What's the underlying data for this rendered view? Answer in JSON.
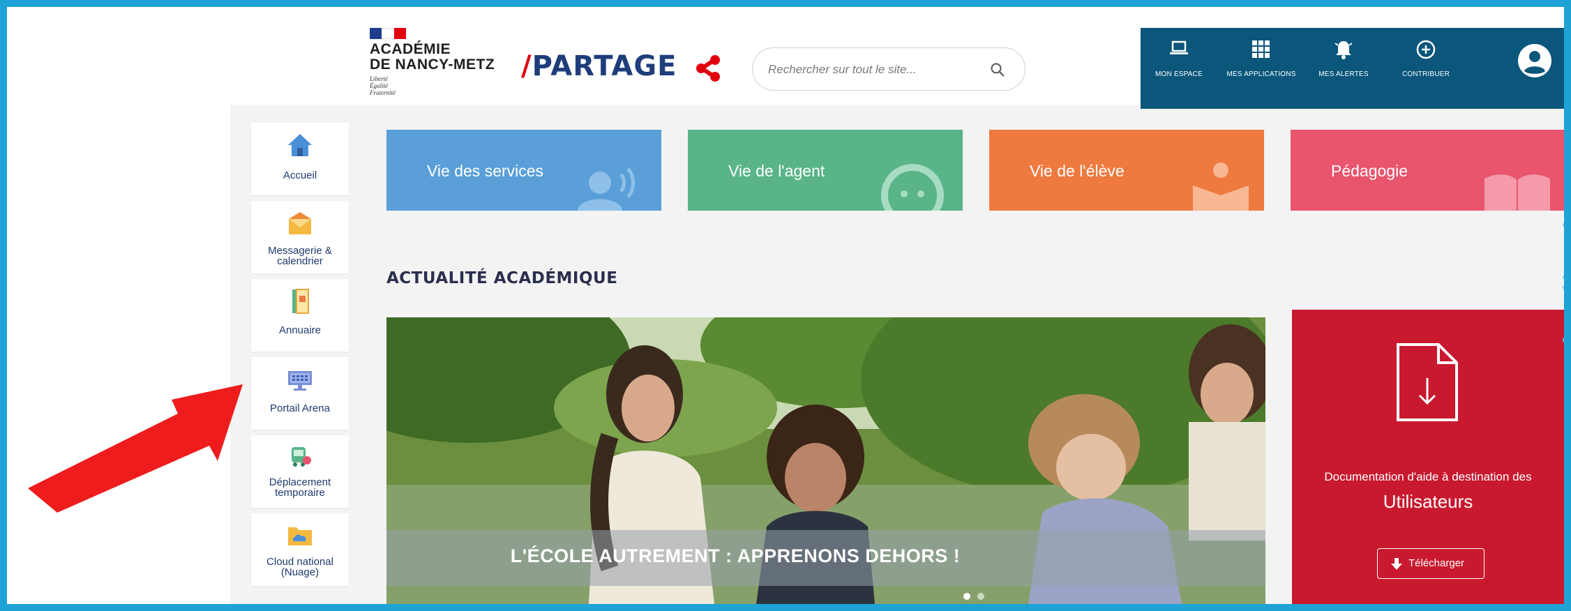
{
  "header": {
    "academy_line1": "ACADÉMIE",
    "academy_line2": "DE NANCY-METZ",
    "motto": [
      "Liberté",
      "Égalité",
      "Fraternité"
    ],
    "app_name": "PARTAGE",
    "app_slash": "/",
    "search_placeholder": "Rechercher sur tout le site..."
  },
  "topbar": {
    "items": [
      {
        "label": "MON ESPACE",
        "icon": "laptop-icon"
      },
      {
        "label": "MES APPLICATIONS",
        "icon": "grid-icon"
      },
      {
        "label": "MES ALERTES",
        "icon": "bell-icon"
      },
      {
        "label": "CONTRIBUER",
        "icon": "plus-circle-icon"
      }
    ],
    "avatar_icon": "user-avatar-icon"
  },
  "sidebar": {
    "items": [
      {
        "label_lines": [
          "Accueil"
        ],
        "icon": "home-icon"
      },
      {
        "label_lines": [
          "Messagerie &",
          "calendrier"
        ],
        "icon": "mail-icon"
      },
      {
        "label_lines": [
          "Annuaire"
        ],
        "icon": "directory-icon"
      },
      {
        "label_lines": [
          "Portail Arena"
        ],
        "icon": "portal-icon"
      },
      {
        "label_lines": [
          "Déplacement",
          "temporaire"
        ],
        "icon": "travel-icon"
      },
      {
        "label_lines": [
          "Cloud national",
          "(Nuage)"
        ],
        "icon": "cloud-folder-icon"
      }
    ]
  },
  "tiles": [
    {
      "label": "Vie des services",
      "color": "#5a9fd8"
    },
    {
      "label": "Vie de l'agent",
      "color": "#59b488"
    },
    {
      "label": "Vie de l'élève",
      "color": "#ee7a3f"
    },
    {
      "label": "Pédagogie",
      "color": "#e8556d"
    }
  ],
  "section": {
    "title": "ACTUALITÉ ACADÉMIQUE"
  },
  "hero": {
    "caption": "L'ÉCOLE AUTREMENT : APPRENONS DEHORS !"
  },
  "help_panel": {
    "line1": "Documentation d'aide à destination des",
    "line2": "Utilisateurs",
    "button_label": "Télécharger",
    "color": "#c8192f"
  },
  "colors": {
    "frame_border": "#1fa3d6",
    "topbar": "#0b567b",
    "brand_blue": "#1e3d7a",
    "brand_red": "#e1000f",
    "arrow": "#ee1c1c"
  }
}
